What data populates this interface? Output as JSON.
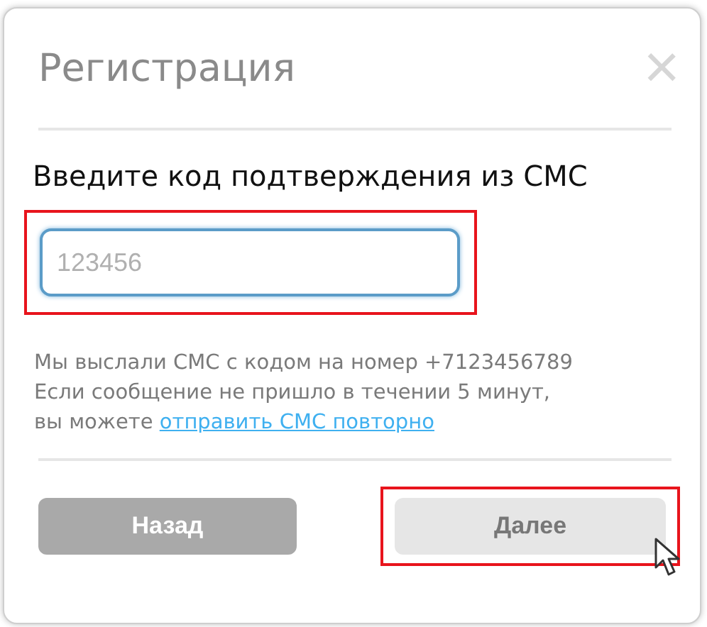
{
  "dialog": {
    "title": "Регистрация",
    "close": "×"
  },
  "heading": "Введите код подтверждения из СМС",
  "code_field": {
    "placeholder": "123456",
    "focused": true,
    "highlighted": true
  },
  "message": {
    "lines": [
      "Мы выслали СМС с кодом на номер +7123456789",
      "Если сообщение не пришло в течении 5 минут,"
    ],
    "prefix": "вы можете",
    "link": "отправить СМС повторно"
  },
  "buttons": [
    {
      "label": "Назад",
      "kind": "back",
      "highlighted": false,
      "hovered": false
    },
    {
      "label": "Далее",
      "kind": "next",
      "highlighted": true,
      "hovered": true
    }
  ]
}
